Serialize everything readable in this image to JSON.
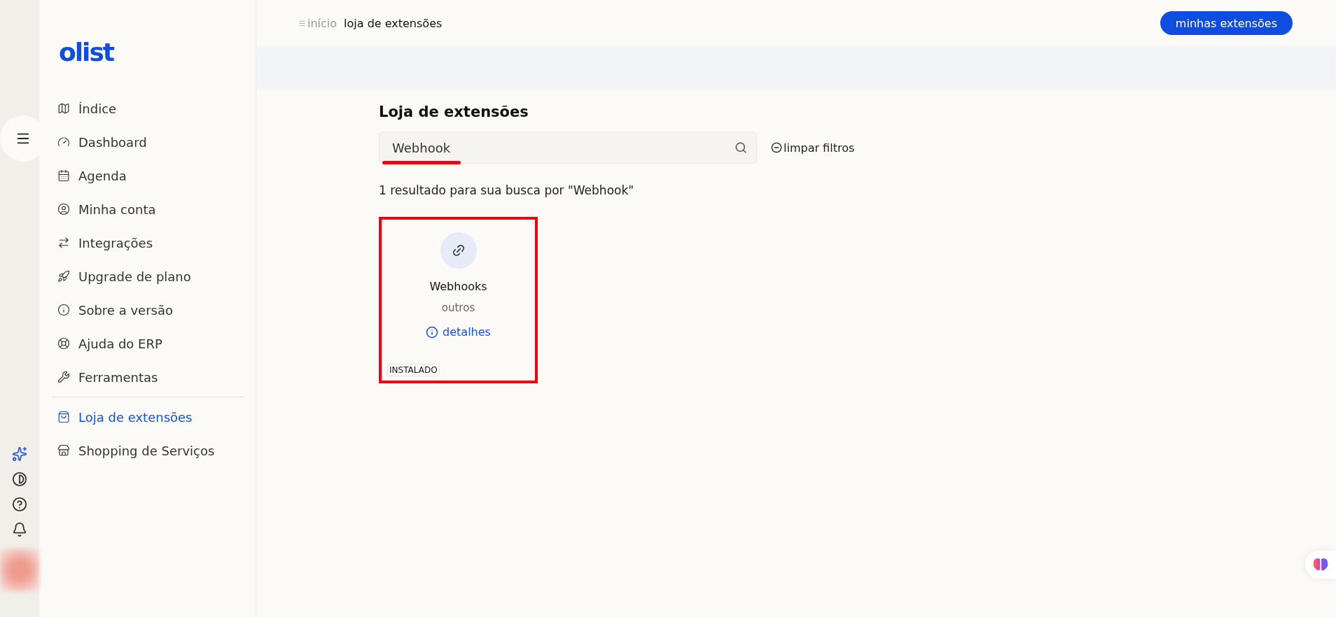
{
  "logo": "olist",
  "sidebar": {
    "items": [
      {
        "label": "Índice",
        "selected": false
      },
      {
        "label": "Dashboard",
        "selected": false
      },
      {
        "label": "Agenda",
        "selected": false
      },
      {
        "label": "Minha conta",
        "selected": false
      },
      {
        "label": "Integrações",
        "selected": false
      },
      {
        "label": "Upgrade de plano",
        "selected": false
      },
      {
        "label": "Sobre a versão",
        "selected": false
      },
      {
        "label": "Ajuda do ERP",
        "selected": false
      },
      {
        "label": "Ferramentas",
        "selected": false,
        "divider_after": true
      },
      {
        "label": "Loja de extensões",
        "selected": true
      },
      {
        "label": "Shopping de Serviços",
        "selected": false
      }
    ]
  },
  "breadcrumb": [
    {
      "label": "início",
      "current": false
    },
    {
      "label": "loja de extensões",
      "current": true
    }
  ],
  "header_button": "minhas extensões",
  "page_title": "Loja de extensões",
  "search": {
    "value": "Webhook"
  },
  "clear_filters": "limpar filtros",
  "results_text": "1 resultado para sua busca por \"Webhook\"",
  "cards": [
    {
      "name": "Webhooks",
      "category": "outros",
      "details": "detalhes",
      "badge": "INSTALADO"
    }
  ]
}
